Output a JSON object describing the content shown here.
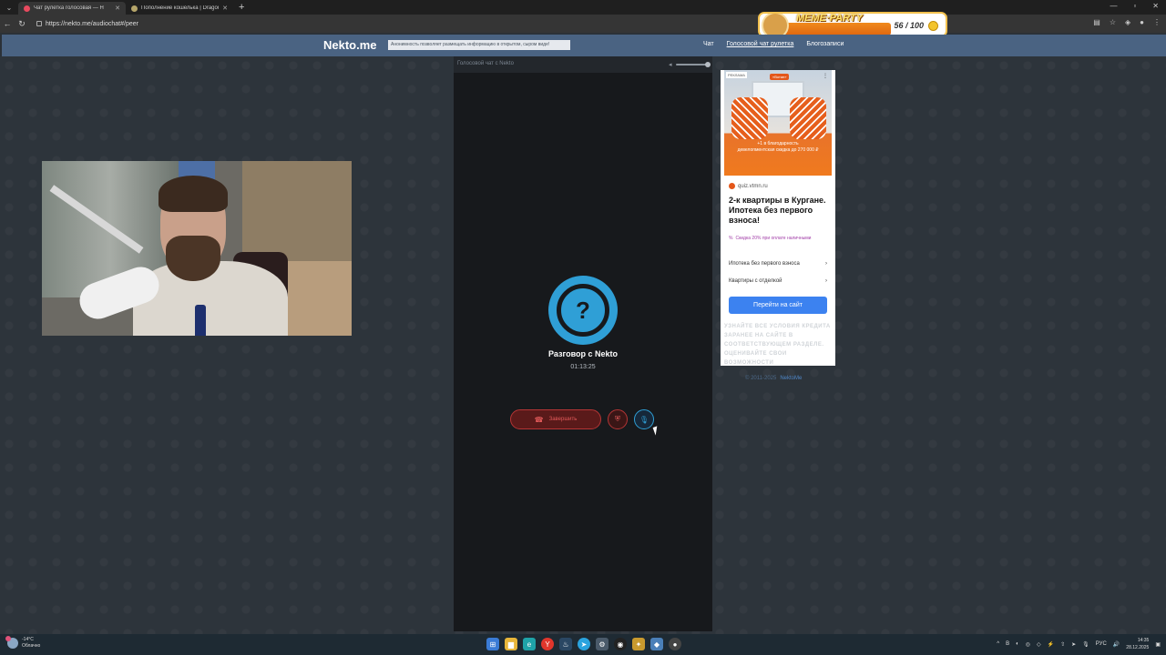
{
  "browser": {
    "tabs": [
      {
        "title": "Чат рулетка голосовая — Н",
        "active": true,
        "favicon_color": "#e84a5f"
      },
      {
        "title": "Пополнение кошелька | Dragon",
        "active": false,
        "favicon_color": "#b5a56a"
      }
    ],
    "url": "https://nekto.me/audiochat#/peer"
  },
  "overlay": {
    "title": "MEME·PARTY",
    "progress_value": 56,
    "progress_max": 100,
    "progress_text": "56 / 100"
  },
  "site": {
    "logo": "Nekto.me",
    "notice": "Анонимность позволяет размещать информацию в открытом, сыром виде!",
    "menu": [
      {
        "label": "Чат",
        "active": false
      },
      {
        "label": "Голосовой чат рулетка",
        "active": true
      },
      {
        "label": "Блогозаписи",
        "active": false
      }
    ]
  },
  "chat": {
    "header_label": "Голосовой чат с Nekto",
    "avatar_symbol": "?",
    "peer_name": "Разговор с Nekto",
    "timer": "01:13:25",
    "end_label": "Завершить"
  },
  "ad": {
    "tag": "РЕКЛАМА",
    "brand": "«Вотан»",
    "promo": "+1 в благодарность\nдевелопментская скидка до 270 000 ₽",
    "site": "quiz.vtmn.ru",
    "headline": "2-к квартиры в Кургане. Ипотека без первого взноса!",
    "discount_icon": "%",
    "discount": "Скидка 20% при оплате наличными",
    "options": [
      "Ипотека без первого взноса",
      "Квартиры с отделкой"
    ],
    "cta": "Перейти на сайт",
    "disclaimer": "УЗНАЙТЕ ВСЕ УСЛОВИЯ КРЕДИТА ЗАРАНЕЕ НА САЙТЕ В СООТВЕТСТВУЮЩЕМ РАЗДЕЛЕ. ОЦЕНИВАЙТЕ СВОИ ВОЗМОЖНОСТИ"
  },
  "footer": {
    "copyright": "© 2011-2025",
    "link": "NektoMe"
  },
  "taskbar": {
    "weather_temp": "-14°C",
    "weather_desc": "Облачно",
    "lang": "РУС",
    "time": "14:35",
    "date": "28.12.2025"
  },
  "colors": {
    "accent_blue": "#2f9fd6",
    "end_red": "#e35a5a",
    "header_bg": "#4a6382",
    "cta_blue": "#3c82f0"
  }
}
